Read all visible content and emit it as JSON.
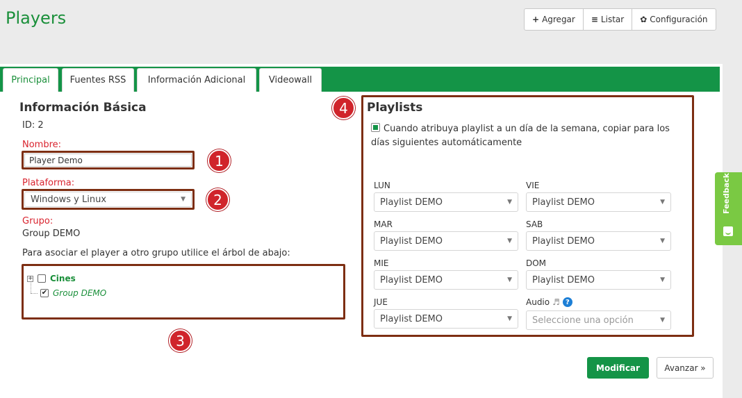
{
  "header": {
    "title": "Players",
    "toolbar": [
      {
        "icon": "plus-icon",
        "glyph": "+",
        "label": "Agregar"
      },
      {
        "icon": "list-icon",
        "glyph": "≡",
        "label": "Listar"
      },
      {
        "icon": "gear-icon",
        "glyph": "✿",
        "label": "Configuración"
      }
    ]
  },
  "tabs": [
    {
      "label": "Principal",
      "active": true
    },
    {
      "label": "Fuentes RSS"
    },
    {
      "label": "Información Adicional"
    },
    {
      "label": "Videowall"
    }
  ],
  "info": {
    "title": "Información Básica",
    "id_text": "ID: 2",
    "nombre_label": "Nombre:",
    "nombre_value": "Player Demo",
    "plataforma_label": "Plataforma:",
    "plataforma_value": "Windows y Linux",
    "grupo_label": "Grupo:",
    "grupo_value": "Group DEMO",
    "tree_hint": "Para asociar el player a otro grupo utilice el árbol de abajo:",
    "tree": [
      {
        "label": "Cines",
        "checked": false
      },
      {
        "label": "Group DEMO",
        "checked": true
      }
    ]
  },
  "playlists": {
    "title": "Playlists",
    "copy_option": {
      "checked": true,
      "line1": "Cuando atribuya playlist a un día de la semana, copiar para los",
      "line2": "días siguientes automáticamente"
    },
    "days": {
      "lun": {
        "label": "LUN",
        "value": "Playlist DEMO"
      },
      "mar": {
        "label": "MAR",
        "value": "Playlist DEMO"
      },
      "mie": {
        "label": "MIE",
        "value": "Playlist DEMO"
      },
      "jue": {
        "label": "JUE",
        "value": "Playlist DEMO"
      },
      "vie": {
        "label": "VIE",
        "value": "Playlist DEMO"
      },
      "sab": {
        "label": "SAB",
        "value": "Playlist DEMO"
      },
      "dom": {
        "label": "DOM",
        "value": "Playlist DEMO"
      }
    },
    "audio": {
      "label": "Audio",
      "music_glyph": "♬",
      "help_glyph": "?",
      "placeholder": "Seleccione una opción"
    }
  },
  "badges": [
    "1",
    "2",
    "3",
    "4"
  ],
  "actions": {
    "modificar": "Modificar",
    "avanzar": "Avanzar »"
  },
  "feedback": {
    "label": "Feedback"
  },
  "colors": {
    "brand_green": "#149447",
    "title_green": "#1a8f3a",
    "label_red": "#d9232e",
    "annotation_box": "#7d2e12",
    "badge_red": "#d0242b",
    "feedback_green": "#7ac943"
  }
}
